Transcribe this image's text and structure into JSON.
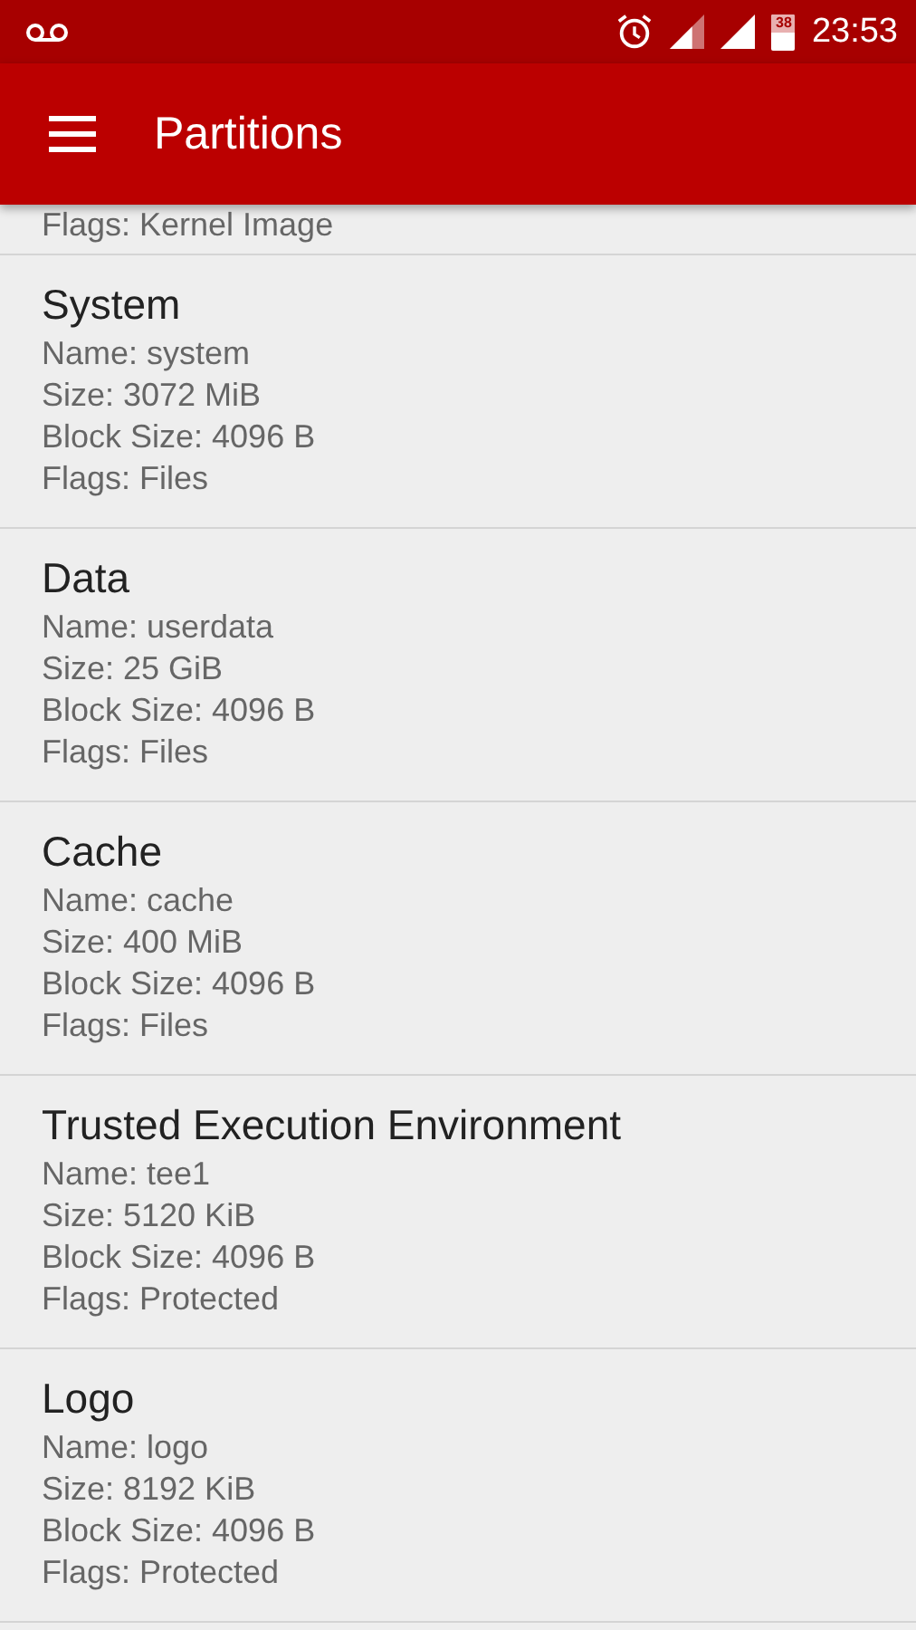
{
  "status_bar": {
    "time": "23:53",
    "battery_text": "38"
  },
  "app_bar": {
    "title": "Partitions"
  },
  "partial_item": {
    "lines": [
      "Flags: Kernel Image"
    ]
  },
  "partitions": [
    {
      "title": "System",
      "lines": [
        "Name: system",
        "Size: 3072 MiB",
        "Block Size: 4096 B",
        "Flags: Files"
      ]
    },
    {
      "title": "Data",
      "lines": [
        "Name: userdata",
        "Size: 25 GiB",
        "Block Size: 4096 B",
        "Flags: Files"
      ]
    },
    {
      "title": "Cache",
      "lines": [
        "Name: cache",
        "Size: 400 MiB",
        "Block Size: 4096 B",
        "Flags: Files"
      ]
    },
    {
      "title": "Trusted Execution Environment",
      "lines": [
        "Name: tee1",
        "Size: 5120 KiB",
        "Block Size: 4096 B",
        "Flags: Protected"
      ]
    },
    {
      "title": "Logo",
      "lines": [
        "Name: logo",
        "Size: 8192 KiB",
        "Block Size: 4096 B",
        "Flags: Protected"
      ]
    }
  ]
}
